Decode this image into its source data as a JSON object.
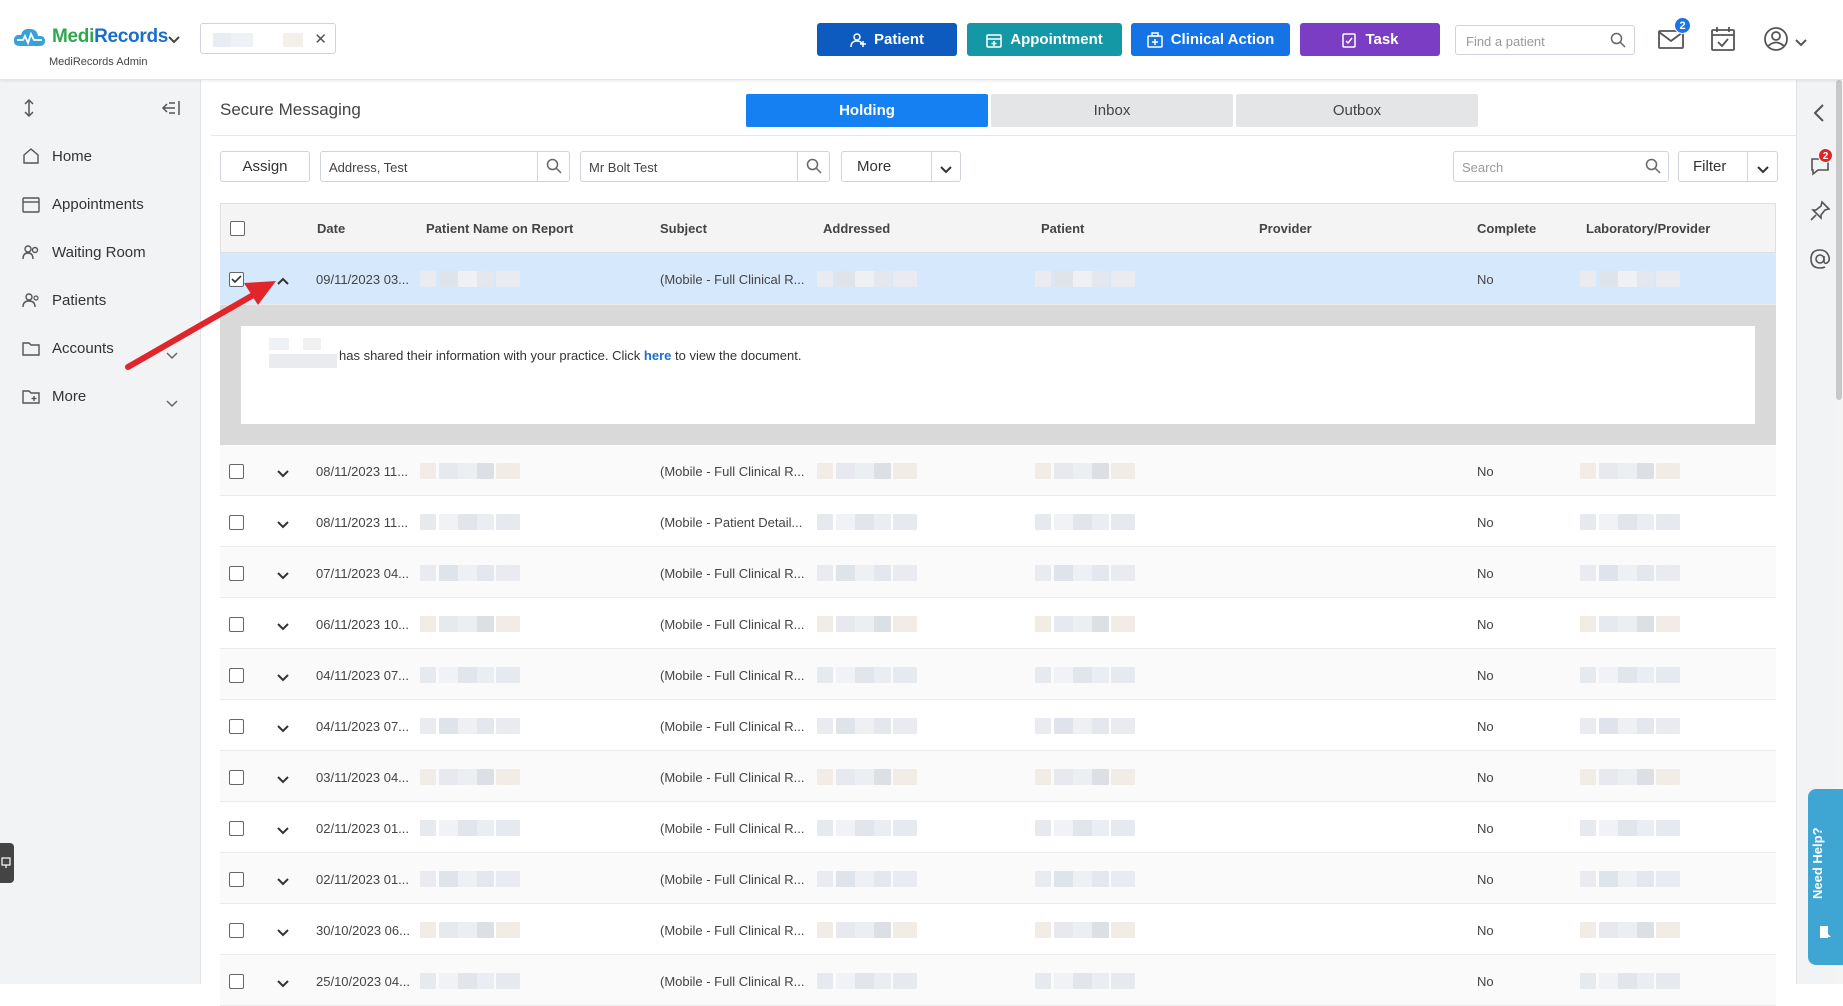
{
  "brand": {
    "name_part1": "Medi",
    "name_part2": "Records",
    "subtitle": "MediRecords Admin"
  },
  "header": {
    "buttons": [
      {
        "label": "Patient",
        "color": "#0d5bbf"
      },
      {
        "label": "Appointment",
        "color": "#1598a6"
      },
      {
        "label": "Clinical Action",
        "color": "#1573e6"
      },
      {
        "label": "Task",
        "color": "#7b3dc3"
      }
    ],
    "find_placeholder": "Find a patient",
    "mail_badge": "2"
  },
  "sidebar": {
    "items": [
      {
        "label": "Home",
        "icon": "home-icon"
      },
      {
        "label": "Appointments",
        "icon": "calendar-icon"
      },
      {
        "label": "Waiting Room",
        "icon": "people-icon"
      },
      {
        "label": "Patients",
        "icon": "person-icon"
      },
      {
        "label": "Accounts",
        "icon": "folder-icon"
      },
      {
        "label": "More",
        "icon": "folder-more-icon"
      }
    ]
  },
  "page": {
    "title": "Secure Messaging",
    "tabs": [
      "Holding",
      "Inbox",
      "Outbox"
    ],
    "active_tab": "Holding"
  },
  "toolbar": {
    "assign_label": "Assign",
    "address_value": "Address, Test",
    "patient_value": "Mr Bolt Test",
    "more_label": "More",
    "search_placeholder": "Search",
    "filter_label": "Filter"
  },
  "table": {
    "columns": [
      "Date",
      "Patient Name on Report",
      "Subject",
      "Addressed",
      "Patient",
      "Provider",
      "Complete",
      "Laboratory/Provider"
    ],
    "expanded_message": {
      "before": "has shared their information with your practice. Click ",
      "link": "here",
      "after": " to view the document."
    },
    "rows": [
      {
        "date": "09/11/2023 03...",
        "subject": "(Mobile - Full Clinical R...",
        "complete": "No",
        "checked": true,
        "expanded": true
      },
      {
        "date": "08/11/2023 11...",
        "subject": "(Mobile - Full Clinical R...",
        "complete": "No"
      },
      {
        "date": "08/11/2023 11...",
        "subject": "(Mobile - Patient Detail...",
        "complete": "No"
      },
      {
        "date": "07/11/2023 04...",
        "subject": "(Mobile - Full Clinical R...",
        "complete": "No"
      },
      {
        "date": "06/11/2023 10...",
        "subject": "(Mobile - Full Clinical R...",
        "complete": "No"
      },
      {
        "date": "04/11/2023 07...",
        "subject": "(Mobile - Full Clinical R...",
        "complete": "No"
      },
      {
        "date": "04/11/2023 07...",
        "subject": "(Mobile - Full Clinical R...",
        "complete": "No"
      },
      {
        "date": "03/11/2023 04...",
        "subject": "(Mobile - Full Clinical R...",
        "complete": "No"
      },
      {
        "date": "02/11/2023 01...",
        "subject": "(Mobile - Full Clinical R...",
        "complete": "No"
      },
      {
        "date": "02/11/2023 01...",
        "subject": "(Mobile - Full Clinical R...",
        "complete": "No"
      },
      {
        "date": "30/10/2023 06...",
        "subject": "(Mobile - Full Clinical R...",
        "complete": "No"
      },
      {
        "date": "25/10/2023 04...",
        "subject": "(Mobile - Full Clinical R...",
        "complete": "No"
      }
    ]
  },
  "right_rail": {
    "chat_badge": "2",
    "help_label": "Need Help?"
  },
  "colors": {
    "accent": "#1480f2",
    "selected_row": "#d6e8fb",
    "link": "#1a6fc9",
    "arrow": "#e0262a"
  }
}
